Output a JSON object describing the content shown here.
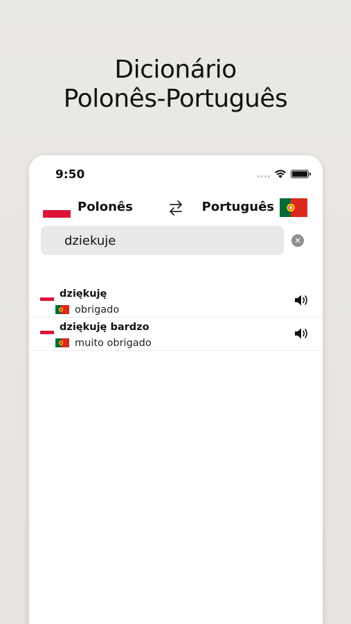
{
  "headline": {
    "line1": "Dicionário",
    "line2": "Polonês-Português"
  },
  "status_bar": {
    "time": "9:50",
    "icons": [
      "cellular-signal-icon",
      "wifi-icon",
      "battery-icon"
    ]
  },
  "languages": {
    "source": {
      "label": "Polonês",
      "flag": "poland-flag-icon"
    },
    "target": {
      "label": "Português",
      "flag": "portugal-flag-icon"
    },
    "swap_icon": "swap-arrows-icon"
  },
  "search": {
    "value": "dziekuje",
    "clear_icon": "clear-circle-icon"
  },
  "results": [
    {
      "term": "dziękuję",
      "translation": "obrigado",
      "audio_icon": "speaker-icon"
    },
    {
      "term": "dziękuję bardzo",
      "translation": "muito obrigado",
      "audio_icon": "speaker-icon"
    }
  ],
  "colors": {
    "background": "#e9e6e3",
    "poland_red": "#dc143c",
    "portugal_green": "#046a38",
    "portugal_red": "#da291c",
    "search_field": "#e9e9ea"
  }
}
